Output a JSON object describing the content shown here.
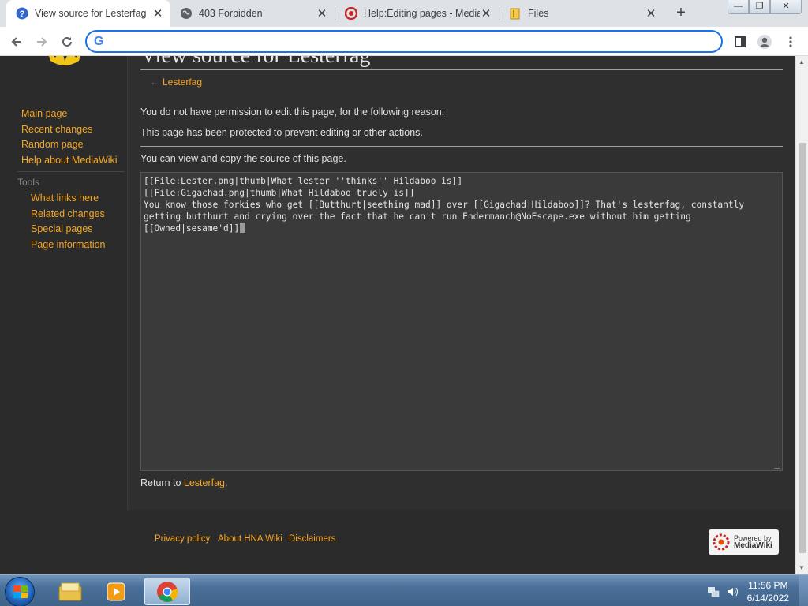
{
  "browser": {
    "tabs": [
      {
        "title": "View source for Lesterfag",
        "favicon": "help-question-icon",
        "active": true
      },
      {
        "title": "403 Forbidden",
        "favicon": "globe-icon",
        "active": false
      },
      {
        "title": "Help:Editing pages - MediaWiki",
        "favicon": "mediawiki-icon",
        "active": false
      },
      {
        "title": "Files",
        "favicon": "folder-icon",
        "active": false
      }
    ],
    "close_glyph": "✕",
    "new_tab_glyph": "+",
    "address_value": "",
    "window_buttons": {
      "minimize": "—",
      "maximize": "❐",
      "close": "✕"
    }
  },
  "sidebar": {
    "navigation": [
      "Main page",
      "Recent changes",
      "Random page",
      "Help about MediaWiki"
    ],
    "tools_heading": "Tools",
    "tools": [
      "What links here",
      "Related changes",
      "Special pages",
      "Page information"
    ]
  },
  "content": {
    "heading": "View source for Lesterfag",
    "sub_dash": "←",
    "sub_link": "Lesterfag",
    "reason_intro": "You do not have permission to edit this page, for the following reason:",
    "reason": "This page has been protected to prevent editing or other actions.",
    "view_copy": "You can view and copy the source of this page.",
    "source": "[[File:Lester.png|thumb|What lester ''thinks'' Hildaboo is]]\n[[File:Gigachad.png|thumb|What Hildaboo truely is]]\nYou know those forkies who get [[Butthurt|seething mad]] over [[Gigachad|Hildaboo]]? That's lesterfag, constantly getting butthurt and crying over the fact that he can't run Endermanch@NoEscape.exe without him getting [[Owned|sesame'd]]",
    "return_prefix": "Return to ",
    "return_link": "Lesterfag",
    "return_suffix": "."
  },
  "footer": {
    "links": [
      "Privacy policy",
      "About HNA Wiki",
      "Disclaimers"
    ],
    "powered_line1": "Powered by",
    "powered_line2": "MediaWiki"
  },
  "taskbar": {
    "time": "11:56 PM",
    "date": "6/14/2022"
  },
  "colors": {
    "link": "#f5a623",
    "page_bg": "#2b2b2b",
    "content_bg": "#2f2f2f",
    "accent_focus": "#1a73e8"
  }
}
